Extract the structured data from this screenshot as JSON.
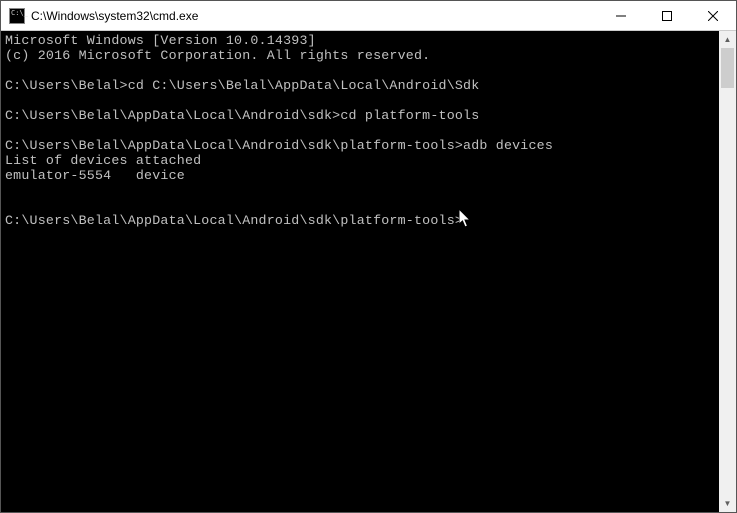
{
  "window": {
    "title": "C:\\Windows\\system32\\cmd.exe"
  },
  "terminal": {
    "banner_line1": "Microsoft Windows [Version 10.0.14393]",
    "banner_line2": "(c) 2016 Microsoft Corporation. All rights reserved.",
    "entries": [
      {
        "prompt": "C:\\Users\\Belal>",
        "command": "cd C:\\Users\\Belal\\AppData\\Local\\Android\\Sdk",
        "output": ""
      },
      {
        "prompt": "C:\\Users\\Belal\\AppData\\Local\\Android\\sdk>",
        "command": "cd platform-tools",
        "output": ""
      },
      {
        "prompt": "C:\\Users\\Belal\\AppData\\Local\\Android\\sdk\\platform-tools>",
        "command": "adb devices",
        "output": "List of devices attached\nemulator-5554   device\n"
      }
    ],
    "current_prompt": "C:\\Users\\Belal\\AppData\\Local\\Android\\sdk\\platform-tools>"
  }
}
